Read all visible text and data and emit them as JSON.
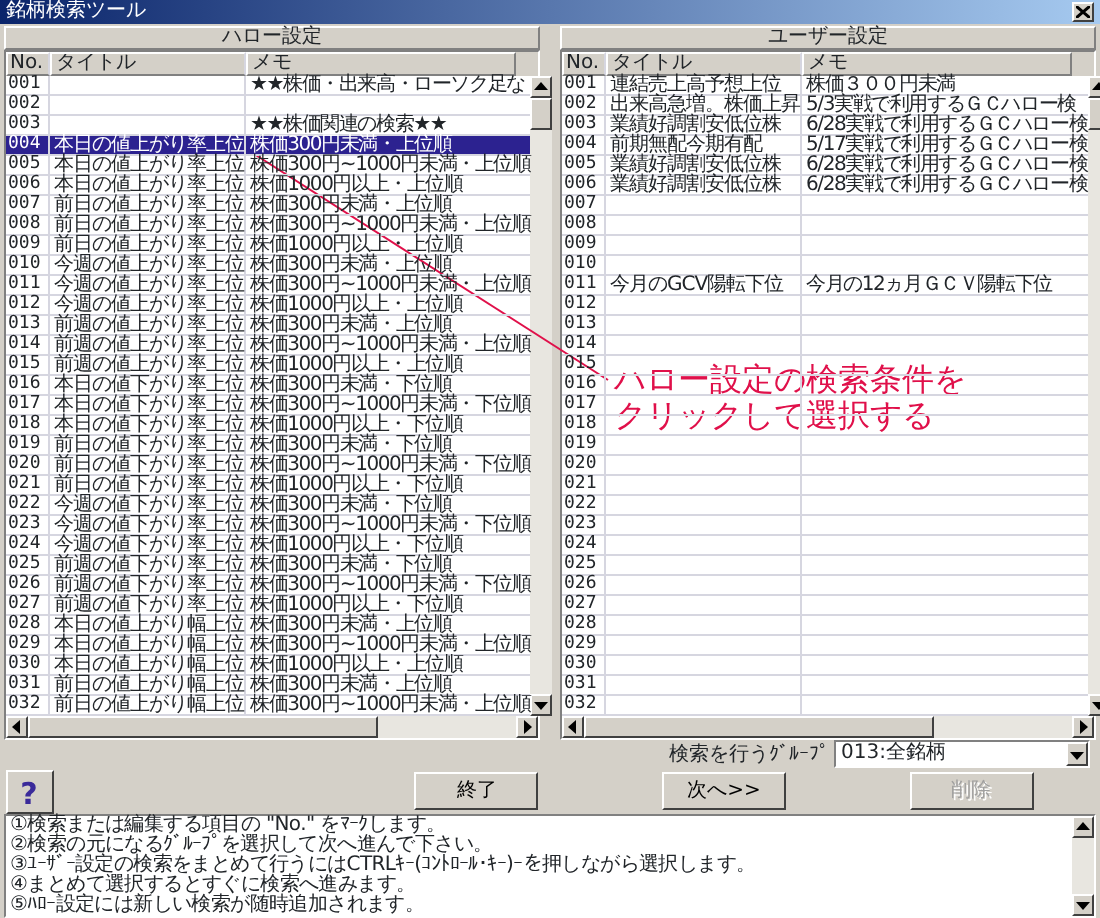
{
  "window": {
    "title": "銘柄検索ツール"
  },
  "panels": [
    {
      "title": "ハロー設定",
      "columns": [
        "No.",
        "タイトル",
        "メモ"
      ],
      "rows": [
        {
          "no": "001",
          "title": "",
          "memo": "★★株価・出来高・ローソク足な",
          "selected": false
        },
        {
          "no": "002",
          "title": "",
          "memo": "",
          "selected": false
        },
        {
          "no": "003",
          "title": "",
          "memo": "★★株価関連の検索★★",
          "selected": false
        },
        {
          "no": "004",
          "title": "本日の値上がり率上位",
          "memo": "株価300円未満・上位順",
          "selected": true
        },
        {
          "no": "005",
          "title": "本日の値上がり率上位",
          "memo": "株価300円~1000円未満・上位順",
          "selected": false
        },
        {
          "no": "006",
          "title": "本日の値上がり率上位",
          "memo": "株価1000円以上・上位順",
          "selected": false
        },
        {
          "no": "007",
          "title": "前日の値上がり率上位",
          "memo": "株価300円未満・上位順",
          "selected": false
        },
        {
          "no": "008",
          "title": "前日の値上がり率上位",
          "memo": "株価300円~1000円未満・上位順",
          "selected": false
        },
        {
          "no": "009",
          "title": "前日の値上がり率上位",
          "memo": "株価1000円以上・上位順",
          "selected": false
        },
        {
          "no": "010",
          "title": "今週の値上がり率上位",
          "memo": "株価300円未満・上位順",
          "selected": false
        },
        {
          "no": "011",
          "title": "今週の値上がり率上位",
          "memo": "株価300円~1000円未満・上位順",
          "selected": false
        },
        {
          "no": "012",
          "title": "今週の値上がり率上位",
          "memo": "株価1000円以上・上位順",
          "selected": false
        },
        {
          "no": "013",
          "title": "前週の値上がり率上位",
          "memo": "株価300円未満・上位順",
          "selected": false
        },
        {
          "no": "014",
          "title": "前週の値上がり率上位",
          "memo": "株価300円~1000円未満・上位順",
          "selected": false
        },
        {
          "no": "015",
          "title": "前週の値上がり率上位",
          "memo": "株価1000円以上・上位順",
          "selected": false
        },
        {
          "no": "016",
          "title": "本日の値下がり率上位",
          "memo": "株価300円未満・下位順",
          "selected": false
        },
        {
          "no": "017",
          "title": "本日の値下がり率上位",
          "memo": "株価300円~1000円未満・下位順",
          "selected": false
        },
        {
          "no": "018",
          "title": "本日の値下がり率上位",
          "memo": "株価1000円以上・下位順",
          "selected": false
        },
        {
          "no": "019",
          "title": "前日の値下がり率上位",
          "memo": "株価300円未満・下位順",
          "selected": false
        },
        {
          "no": "020",
          "title": "前日の値下がり率上位",
          "memo": "株価300円~1000円未満・下位順",
          "selected": false
        },
        {
          "no": "021",
          "title": "前日の値下がり率上位",
          "memo": "株価1000円以上・下位順",
          "selected": false
        },
        {
          "no": "022",
          "title": "今週の値下がり率上位",
          "memo": "株価300円未満・下位順",
          "selected": false
        },
        {
          "no": "023",
          "title": "今週の値下がり率上位",
          "memo": "株価300円~1000円未満・下位順",
          "selected": false
        },
        {
          "no": "024",
          "title": "今週の値下がり率上位",
          "memo": "株価1000円以上・下位順",
          "selected": false
        },
        {
          "no": "025",
          "title": "前週の値下がり率上位",
          "memo": "株価300円未満・下位順",
          "selected": false
        },
        {
          "no": "026",
          "title": "前週の値下がり率上位",
          "memo": "株価300円~1000円未満・下位順",
          "selected": false
        },
        {
          "no": "027",
          "title": "前週の値下がり率上位",
          "memo": "株価1000円以上・下位順",
          "selected": false
        },
        {
          "no": "028",
          "title": "本日の値上がり幅上位",
          "memo": "株価300円未満・上位順",
          "selected": false
        },
        {
          "no": "029",
          "title": "本日の値上がり幅上位",
          "memo": "株価300円~1000円未満・上位順",
          "selected": false
        },
        {
          "no": "030",
          "title": "本日の値上がり幅上位",
          "memo": "株価1000円以上・上位順",
          "selected": false
        },
        {
          "no": "031",
          "title": "前日の値上がり幅上位",
          "memo": "株価300円未満・上位順",
          "selected": false
        },
        {
          "no": "032",
          "title": "前日の値上がり幅上位",
          "memo": "株価300円~1000円未満・上位順",
          "selected": false
        }
      ]
    },
    {
      "title": "ユーザー設定",
      "columns": [
        "No.",
        "タイトル",
        "メモ"
      ],
      "rows": [
        {
          "no": "001",
          "title": "連結売上高予想上位",
          "memo": "株価３００円未満",
          "selected": false
        },
        {
          "no": "002",
          "title": "出来高急増。株価上昇",
          "memo": "5/3実戦で利用するＧＣハロー検",
          "selected": false
        },
        {
          "no": "003",
          "title": "業績好調割安低位株",
          "memo": "6/28実戦で利用するＧＣハロー検",
          "selected": false
        },
        {
          "no": "004",
          "title": "前期無配今期有配",
          "memo": "5/17実戦で利用するＧＣハロー検",
          "selected": false
        },
        {
          "no": "005",
          "title": "業績好調割安低位株",
          "memo": "6/28実戦で利用するＧＣハロー検",
          "selected": false
        },
        {
          "no": "006",
          "title": "業績好調割安低位株",
          "memo": "6/28実戦で利用するＧＣハロー検",
          "selected": false
        },
        {
          "no": "007",
          "title": "",
          "memo": "",
          "selected": false
        },
        {
          "no": "008",
          "title": "",
          "memo": "",
          "selected": false
        },
        {
          "no": "009",
          "title": "",
          "memo": "",
          "selected": false
        },
        {
          "no": "010",
          "title": "",
          "memo": "",
          "selected": false
        },
        {
          "no": "011",
          "title": "今月のGCV陽転下位",
          "memo": "今月の12ヵ月ＧＣＶ陽転下位",
          "selected": false
        },
        {
          "no": "012",
          "title": "",
          "memo": "",
          "selected": false
        },
        {
          "no": "013",
          "title": "",
          "memo": "",
          "selected": false
        },
        {
          "no": "014",
          "title": "",
          "memo": "",
          "selected": false
        },
        {
          "no": "015",
          "title": "",
          "memo": "",
          "selected": false
        },
        {
          "no": "016",
          "title": "",
          "memo": "",
          "selected": false
        },
        {
          "no": "017",
          "title": "",
          "memo": "",
          "selected": false
        },
        {
          "no": "018",
          "title": "",
          "memo": "",
          "selected": false
        },
        {
          "no": "019",
          "title": "",
          "memo": "",
          "selected": false
        },
        {
          "no": "020",
          "title": "",
          "memo": "",
          "selected": false
        },
        {
          "no": "021",
          "title": "",
          "memo": "",
          "selected": false
        },
        {
          "no": "022",
          "title": "",
          "memo": "",
          "selected": false
        },
        {
          "no": "023",
          "title": "",
          "memo": "",
          "selected": false
        },
        {
          "no": "024",
          "title": "",
          "memo": "",
          "selected": false
        },
        {
          "no": "025",
          "title": "",
          "memo": "",
          "selected": false
        },
        {
          "no": "026",
          "title": "",
          "memo": "",
          "selected": false
        },
        {
          "no": "027",
          "title": "",
          "memo": "",
          "selected": false
        },
        {
          "no": "028",
          "title": "",
          "memo": "",
          "selected": false
        },
        {
          "no": "029",
          "title": "",
          "memo": "",
          "selected": false
        },
        {
          "no": "030",
          "title": "",
          "memo": "",
          "selected": false
        },
        {
          "no": "031",
          "title": "",
          "memo": "",
          "selected": false
        },
        {
          "no": "032",
          "title": "",
          "memo": "",
          "selected": false
        }
      ]
    }
  ],
  "group_field": {
    "label": "検索を行うｸﾞﾙｰﾌﾟ",
    "value": "013:全銘柄"
  },
  "help_button": {
    "label": "?"
  },
  "buttons": [
    {
      "label": "終了",
      "disabled": false
    },
    {
      "label": "次へ>>",
      "disabled": false
    },
    {
      "label": "削除",
      "disabled": true
    }
  ],
  "instructions": [
    "①検索または編集する項目の \"No.\" をﾏｰｸします。",
    "②検索の元になるｸﾞﾙｰﾌﾟを選択して次へ進んで下さい。",
    "③ﾕｰｻﾞｰ設定の検索をまとめて行うにはCTRLｷｰ(ｺﾝﾄﾛｰﾙ･ｷｰ)ｰを押しながら選択します。",
    "④まとめて選択するとすぐに検索へ進みます。",
    "⑤ﾊﾛｰ設定には新しい検索が随時追加されます。"
  ],
  "annotation": {
    "lines": [
      "ハロー設定の検索条件を",
      "クリックして選択する"
    ]
  }
}
